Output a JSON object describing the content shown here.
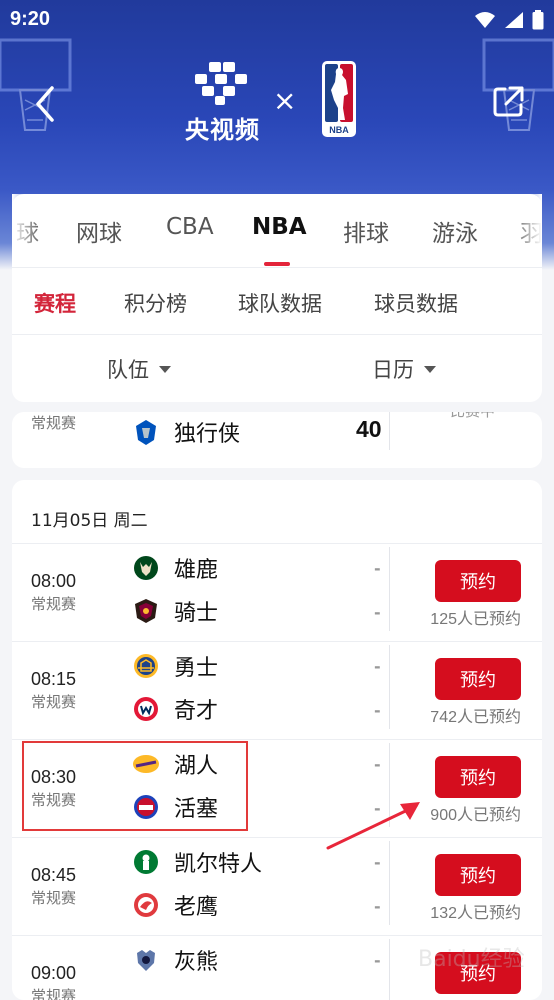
{
  "status_bar": {
    "time": "9:20"
  },
  "header": {
    "brand_name": "央视频",
    "times_sign": "×",
    "nba_logo_text": "NBA"
  },
  "sports_tabs": [
    {
      "label": "球",
      "active": false
    },
    {
      "label": "网球",
      "active": false
    },
    {
      "label": "CBA",
      "active": false
    },
    {
      "label": "NBA",
      "active": true
    },
    {
      "label": "排球",
      "active": false
    },
    {
      "label": "游泳",
      "active": false
    },
    {
      "label": "羽",
      "active": false
    }
  ],
  "sub_tabs": [
    {
      "label": "赛程",
      "active": true
    },
    {
      "label": "积分榜",
      "active": false
    },
    {
      "label": "球队数据",
      "active": false
    },
    {
      "label": "球员数据",
      "active": false
    }
  ],
  "filters": {
    "team": "队伍",
    "calendar": "日历"
  },
  "previous_match": {
    "type": "常规赛",
    "team": "独行侠",
    "score": "40",
    "status": "比赛中"
  },
  "day_section": {
    "date": "11月05日 周二",
    "matches": [
      {
        "time": "08:00",
        "type": "常规赛",
        "home": "雄鹿",
        "away": "骑士",
        "score_home": "-",
        "score_away": "-",
        "button": "预约",
        "count": "125人已预约"
      },
      {
        "time": "08:15",
        "type": "常规赛",
        "home": "勇士",
        "away": "奇才",
        "score_home": "-",
        "score_away": "-",
        "button": "预约",
        "count": "742人已预约"
      },
      {
        "time": "08:30",
        "type": "常规赛",
        "home": "湖人",
        "away": "活塞",
        "score_home": "-",
        "score_away": "-",
        "button": "预约",
        "count": "900人已预约"
      },
      {
        "time": "08:45",
        "type": "常规赛",
        "home": "凯尔特人",
        "away": "老鹰",
        "score_home": "-",
        "score_away": "-",
        "button": "预约",
        "count": "132人已预约"
      },
      {
        "time": "09:00",
        "type": "常规赛",
        "home": "灰熊",
        "away": "",
        "score_home": "-",
        "score_away": "-",
        "button": "预约",
        "count": ""
      }
    ]
  },
  "colors": {
    "accent_red": "#d50d1e",
    "header_blue": "#2a47b8",
    "active_subtab": "#d3253a"
  },
  "watermark_text": "Baidu经验"
}
